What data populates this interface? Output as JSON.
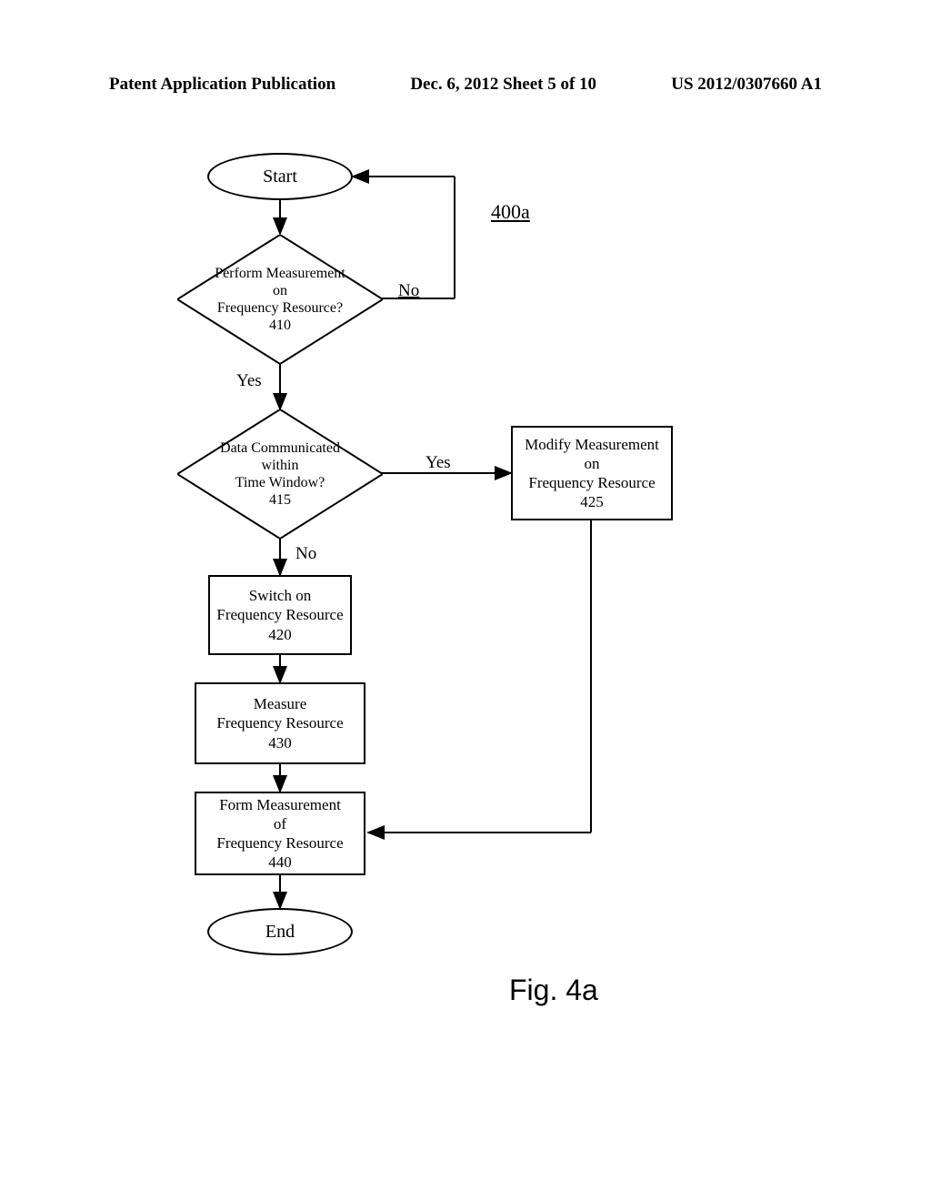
{
  "header": {
    "left": "Patent Application Publication",
    "center": "Dec. 6, 2012  Sheet 5 of 10",
    "right": "US 2012/0307660 A1"
  },
  "flowchart": {
    "figure_id": "400a",
    "start": "Start",
    "end": "End",
    "decision1": {
      "line1": "Perform Measurement",
      "line2": "on",
      "line3": "Frequency Resource?",
      "ref": "410"
    },
    "decision2": {
      "line1": "Data Communicated",
      "line2": "within",
      "line3": "Time Window?",
      "ref": "415"
    },
    "process_modify": {
      "line1": "Modify Measurement",
      "line2": "on",
      "line3": "Frequency Resource",
      "ref": "425"
    },
    "process_switch": {
      "line1": "Switch on",
      "line2": "Frequency Resource",
      "ref": "420"
    },
    "process_measure": {
      "line1": "Measure",
      "line2": "Frequency Resource",
      "ref": "430"
    },
    "process_form": {
      "line1": "Form Measurement",
      "line2": "of",
      "line3": "Frequency Resource",
      "ref": "440"
    },
    "labels": {
      "no": "No",
      "yes": "Yes",
      "no2": "No",
      "yes2": "Yes"
    }
  },
  "figure_caption": "Fig. 4a"
}
